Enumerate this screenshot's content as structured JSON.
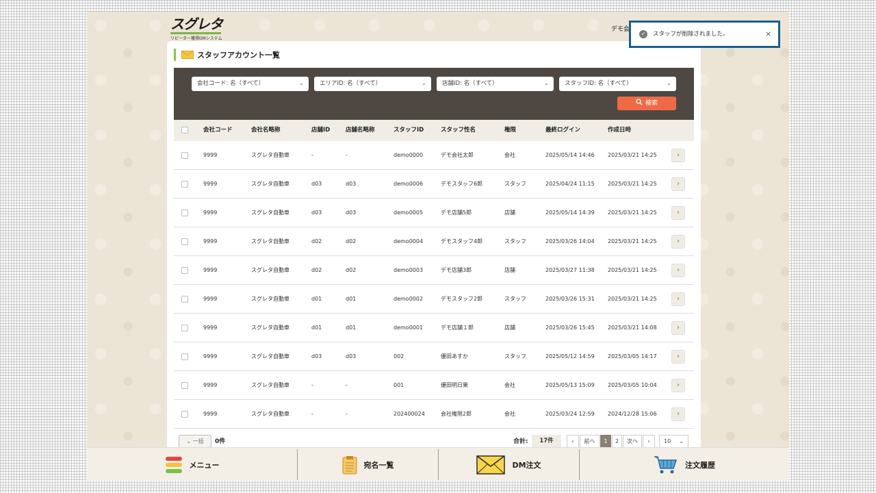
{
  "app": {
    "logo_main": "スグレタ",
    "logo_sub": "リピーター獲得DMシステム",
    "user_label": "デモ会"
  },
  "page": {
    "title": "スタッフアカウント一覧"
  },
  "filters": {
    "company": "会社コード: 名（すべて）",
    "area": "エリアID: 名（すべて）",
    "store": "店舗ID: 名（すべて）",
    "staff": "スタッフID: 名（すべて）",
    "search_label": "検索"
  },
  "table": {
    "headers": [
      "会社コード",
      "会社名略称",
      "店舗ID",
      "店舗名略称",
      "スタッフID",
      "スタッフ性名",
      "権限",
      "最終ログイン",
      "作成日時"
    ],
    "rows": [
      [
        "9999",
        "スグレタ自動車",
        "-",
        "-",
        "demo0000",
        "デモ会社太郎",
        "会社",
        "2025/05/14 14:46",
        "2025/03/21 14:25"
      ],
      [
        "9999",
        "スグレタ自動車",
        "d03",
        "d03",
        "demo0006",
        "デモスタッフ6郎",
        "スタッフ",
        "2025/04/24 11:15",
        "2025/03/21 14:25"
      ],
      [
        "9999",
        "スグレタ自動車",
        "d03",
        "d03",
        "demo0005",
        "デモ店舗5郎",
        "店舗",
        "2025/05/14 14:39",
        "2025/03/21 14:25"
      ],
      [
        "9999",
        "スグレタ自動車",
        "d02",
        "d02",
        "demo0004",
        "デモスタッフ4郎",
        "スタッフ",
        "2025/03/26 14:04",
        "2025/03/21 14:25"
      ],
      [
        "9999",
        "スグレタ自動車",
        "d02",
        "d02",
        "demo0003",
        "デモ店舗3郎",
        "店舗",
        "2025/03/27 11:38",
        "2025/03/21 14:25"
      ],
      [
        "9999",
        "スグレタ自動車",
        "d01",
        "d01",
        "demo0002",
        "デモスタッフ2郎",
        "スタッフ",
        "2025/03/26 15:31",
        "2025/03/21 14:25"
      ],
      [
        "9999",
        "スグレタ自動車",
        "d01",
        "d01",
        "demo0001",
        "デモ店舗１郎",
        "店舗",
        "2025/03/26 15:45",
        "2025/03/21 14:08"
      ],
      [
        "9999",
        "スグレタ自動車",
        "d03",
        "d03",
        "002",
        "優田あすか",
        "スタッフ",
        "2025/05/12 14:59",
        "2025/03/05 14:17"
      ],
      [
        "9999",
        "スグレタ自動車",
        "-",
        "-",
        "001",
        "優田明日果",
        "会社",
        "2025/05/13 15:09",
        "2025/03/05 10:04"
      ],
      [
        "9999",
        "スグレタ自動車",
        "-",
        "-",
        "202400024",
        "会社権限2郎",
        "会社",
        "2025/03/24 12:59",
        "2024/12/28 15:06"
      ]
    ],
    "row_action_glyph": "›"
  },
  "pagination": {
    "bulk_label": "一括",
    "selected_count": "0件",
    "total_label": "合計:",
    "total_value": "17件",
    "prev_glyph": "‹",
    "prev_label": "前へ",
    "pages": [
      "1",
      "2"
    ],
    "next_label": "次へ",
    "next_glyph": "›",
    "per_page": "10"
  },
  "bottom_nav": {
    "menu": "メニュー",
    "addresses": "宛名一覧",
    "dm_order": "DM注文",
    "order_history": "注文履歴"
  },
  "toast": {
    "message": "スタッフが削除されました。",
    "close_glyph": "×"
  },
  "colors": {
    "accent_orange": "#ee6a47",
    "filter_bg": "#4f4842",
    "title_accent": "#8bc34a",
    "toast_border": "#1a5f8f"
  }
}
